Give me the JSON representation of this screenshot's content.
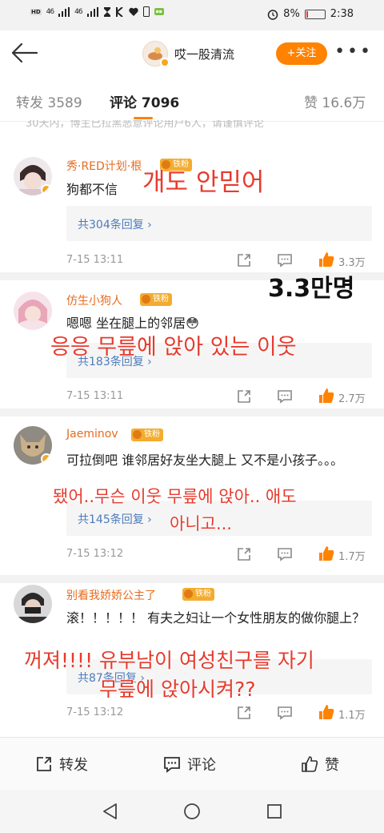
{
  "status_bar": {
    "left_labels": [
      "HD",
      "46",
      "46"
    ],
    "battery_percent": "8%",
    "battery_level": 0.08,
    "time": "2:38"
  },
  "header": {
    "author_name": "哎一股清流",
    "follow_label": "+关注"
  },
  "tabs": {
    "repost": "转发 3589",
    "comment": "评论 7096",
    "like": "赞 16.6万"
  },
  "notice": "30天内，博主已拉黑恶意评论用户6人，请谨慎评论",
  "comments": [
    {
      "name": "秀·RED计划·根",
      "badge": "铁粉",
      "text": "狗都不信",
      "replies": "共304条回复 ›",
      "time": "7-15 13:11",
      "likes": "3.3万"
    },
    {
      "name": "仿生小狗人",
      "badge": "铁粉",
      "text": "嗯嗯 坐在腿上的邻居😳",
      "replies": "共183条回复 ›",
      "time": "7-15 13:11",
      "likes": "2.7万"
    },
    {
      "name": "Jaeminov",
      "badge": "铁粉",
      "text": "可拉倒吧 谁邻居好友坐大腿上 又不是小孩子。。。",
      "replies": "共145条回复 ›",
      "time": "7-15 13:12",
      "likes": "1.7万"
    },
    {
      "name": "别看我娇娇公主了",
      "badge": "铁粉",
      "text": "滚！！！！！ 有夫之妇让一个女性朋友的做你腿上？",
      "replies": "共87条回复 ›",
      "time": "7-15 13:12",
      "likes": "1.1万"
    }
  ],
  "overlays": {
    "c1": "개도 안믿어",
    "count": "3.3만명",
    "c2": "응응 무릎에 앉아 있는 이웃",
    "c3_line1": "됐어..무슨 이웃 무릎에 앉아.. 애도",
    "c3_line2": "아니고...",
    "c4_line1": "꺼져!!!! 유부남이 여성친구를  자기",
    "c4_line2": "무릎에 앉아시켜??"
  },
  "bottom_bar": {
    "repost": "转发",
    "comment": "评论",
    "like": "赞"
  }
}
